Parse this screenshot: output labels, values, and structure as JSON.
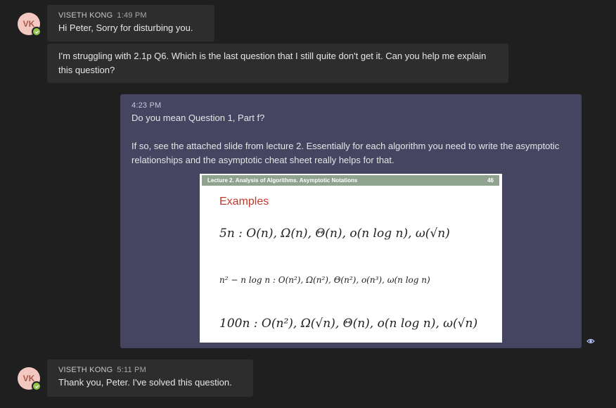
{
  "messages": [
    {
      "avatar": "VK",
      "sender": "VISETH KONG",
      "time": "1:49 PM",
      "lines": [
        "Hi Peter, Sorry for disturbing you.",
        "I'm struggling with 2.1p Q6. Which is the last question that I still quite don't get it. Can you help me explain this question?"
      ]
    },
    {
      "time": "4:23 PM",
      "text1": "Do you mean Question 1, Part f?",
      "text2": "If so, see the attached slide from lecture 2. Essentially for each algorithm you need to write the asymptotic relationships and the asymptotic cheat sheet really helps for that.",
      "slide": {
        "header": "Lecture 2. Analysis of Algorithms. Asymptotic Notations",
        "page": "46",
        "title": "Examples",
        "line1": "5n : O(n), Ω(n), Θ(n), o(n log n), ω(√n)",
        "line2": "n² − n log n : O(n²), Ω(n²), Θ(n²), o(n³), ω(n log n)",
        "line3": "100n : O(n²), Ω(√n), Θ(n), o(n log n), ω(√n)"
      }
    },
    {
      "avatar": "VK",
      "sender": "VISETH KONG",
      "time": "5:11 PM",
      "lines": [
        "Thank you, Peter. I've solved this question."
      ]
    }
  ]
}
